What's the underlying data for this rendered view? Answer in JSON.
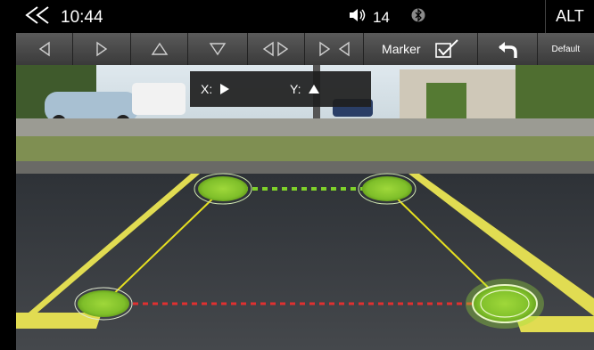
{
  "status": {
    "back_icon": "double-chevron-left-icon",
    "time": "10:44",
    "volume_icon": "speaker-icon",
    "volume": "14",
    "bluetooth_icon": "bluetooth-icon",
    "alt_label": "ALT"
  },
  "toolbar": {
    "buttons": [
      {
        "name": "move-left",
        "icon": "triangle-left-icon"
      },
      {
        "name": "move-right",
        "icon": "triangle-right-icon"
      },
      {
        "name": "move-up",
        "icon": "triangle-up-icon"
      },
      {
        "name": "move-down",
        "icon": "triangle-down-icon"
      },
      {
        "name": "narrow",
        "icon": "narrow-icon"
      },
      {
        "name": "widen",
        "icon": "widen-icon"
      }
    ],
    "marker_label": "Marker",
    "marker_checked": true,
    "undo_icon": "undo-arrow-icon",
    "default_label": "Default"
  },
  "position_panel": {
    "x_label": "X:",
    "x_icon": "triangle-right-icon",
    "y_label": "Y:",
    "y_icon": "triangle-up-icon"
  },
  "overlay": {
    "handle_color": "#7fbf2a",
    "side_line_color": "#e6e020",
    "top_line_color": "#7fd02a",
    "bottom_line_color": "#e03030",
    "handles": [
      "top-left",
      "top-right",
      "bottom-left",
      "bottom-right"
    ],
    "selected_handle": "bottom-right"
  }
}
